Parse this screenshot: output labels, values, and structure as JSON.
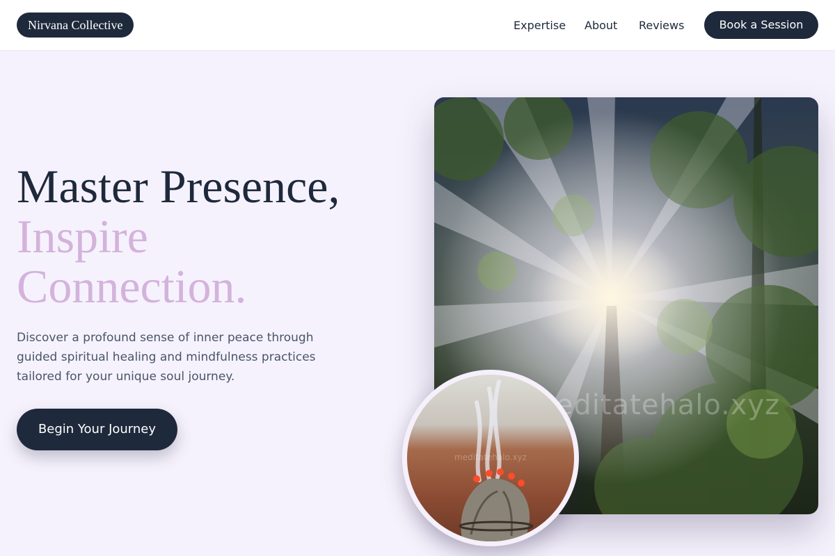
{
  "header": {
    "logo": "Nirvana Collective",
    "nav": [
      "Expertise",
      "About",
      "Reviews"
    ],
    "cta": "Book a Session"
  },
  "hero": {
    "headline_line1": "Master Presence,",
    "headline_line2": "Inspire",
    "headline_line3": "Connection.",
    "description": "Discover a profound sense of inner peace through guided spiritual healing and mindfulness practices tailored for your unique soul journey.",
    "cta": "Begin Your Journey"
  },
  "images": {
    "main_watermark": "meditatehalo.xyz",
    "circle_watermark": "meditatehalo.xyz"
  },
  "colors": {
    "primary": "#1e293b",
    "accent": "#d3b3db",
    "background": "#f6f2fd"
  }
}
